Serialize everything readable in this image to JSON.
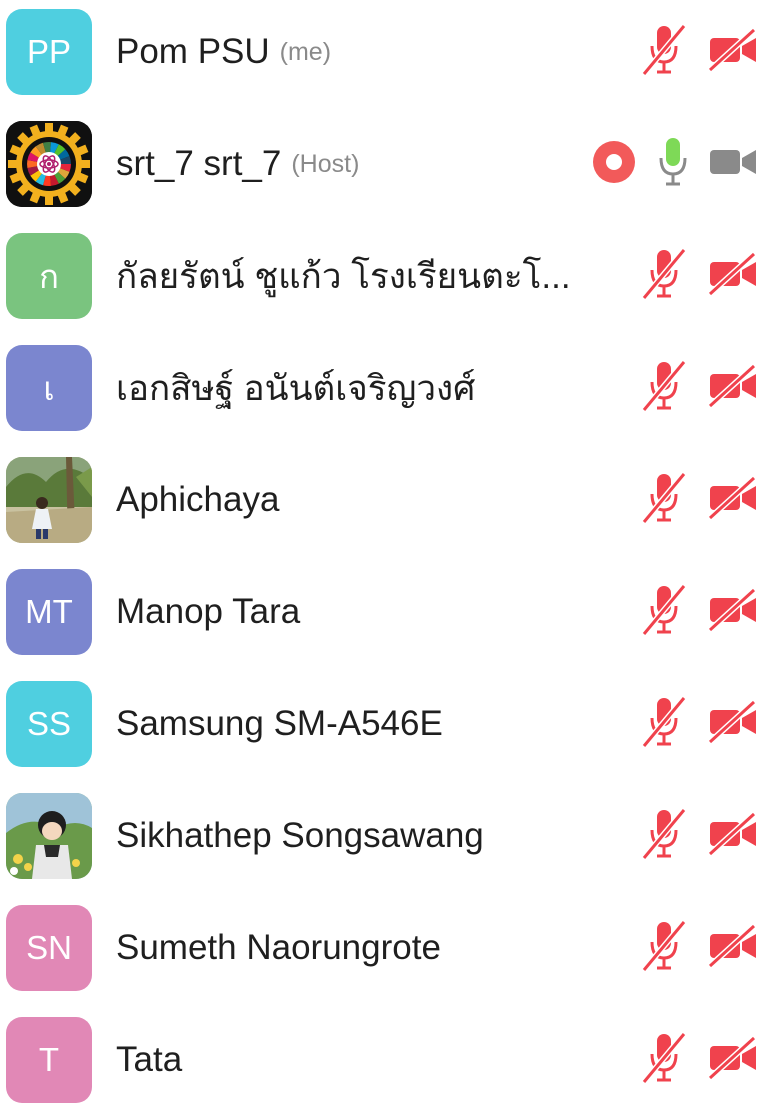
{
  "participants": [
    {
      "initials": "PP",
      "name": "Pom PSU",
      "role": "(me)",
      "avatar_color": "#4fcfe0",
      "avatar_type": "initials",
      "mic": "muted",
      "video": "off",
      "recording": false
    },
    {
      "initials": "",
      "name": "srt_7 srt_7",
      "role": "(Host)",
      "avatar_color": "#101010",
      "avatar_type": "logo-gear",
      "mic": "on",
      "video": "on",
      "recording": true
    },
    {
      "initials": "ก",
      "name": "กัลยรัตน์ ชูแก้ว โรงเรียนตะโ...",
      "role": "",
      "avatar_color": "#7ac47f",
      "avatar_type": "initials",
      "mic": "muted",
      "video": "off",
      "recording": false
    },
    {
      "initials": "เ",
      "name": "เอกสิษฐ์ อนันต์เจริญวงศ์",
      "role": "",
      "avatar_color": "#7b86cf",
      "avatar_type": "initials",
      "mic": "muted",
      "video": "off",
      "recording": false
    },
    {
      "initials": "",
      "name": "Aphichaya",
      "role": "",
      "avatar_color": "#6b8a4a",
      "avatar_type": "photo-outdoor",
      "mic": "muted",
      "video": "off",
      "recording": false
    },
    {
      "initials": "MT",
      "name": "Manop Tara",
      "role": "",
      "avatar_color": "#7b86cf",
      "avatar_type": "initials",
      "mic": "muted",
      "video": "off",
      "recording": false
    },
    {
      "initials": "SS",
      "name": "Samsung SM-A546E",
      "role": "",
      "avatar_color": "#4fcfe0",
      "avatar_type": "initials",
      "mic": "muted",
      "video": "off",
      "recording": false
    },
    {
      "initials": "",
      "name": "Sikhathep Songsawang",
      "role": "",
      "avatar_color": "#8fbf7a",
      "avatar_type": "photo-anime",
      "mic": "muted",
      "video": "off",
      "recording": false
    },
    {
      "initials": "SN",
      "name": "Sumeth Naorungrote",
      "role": "",
      "avatar_color": "#e188b6",
      "avatar_type": "initials",
      "mic": "muted",
      "video": "off",
      "recording": false
    },
    {
      "initials": "T",
      "name": "Tata",
      "role": "",
      "avatar_color": "#e188b6",
      "avatar_type": "initials",
      "mic": "muted",
      "video": "off",
      "recording": false
    }
  ],
  "colors": {
    "muted_red": "#f0424d",
    "recording_red": "#f25a5a",
    "mic_on_green": "#7ed957",
    "video_on_gray": "#8a8a8a",
    "role_gray": "#8a8a8a",
    "name_text": "#1f1f1f"
  },
  "icons": {
    "mic_muted": "microphone-off-icon",
    "mic_on": "microphone-icon",
    "video_off": "video-camera-off-icon",
    "video_on": "video-camera-icon",
    "recording": "recording-icon"
  }
}
